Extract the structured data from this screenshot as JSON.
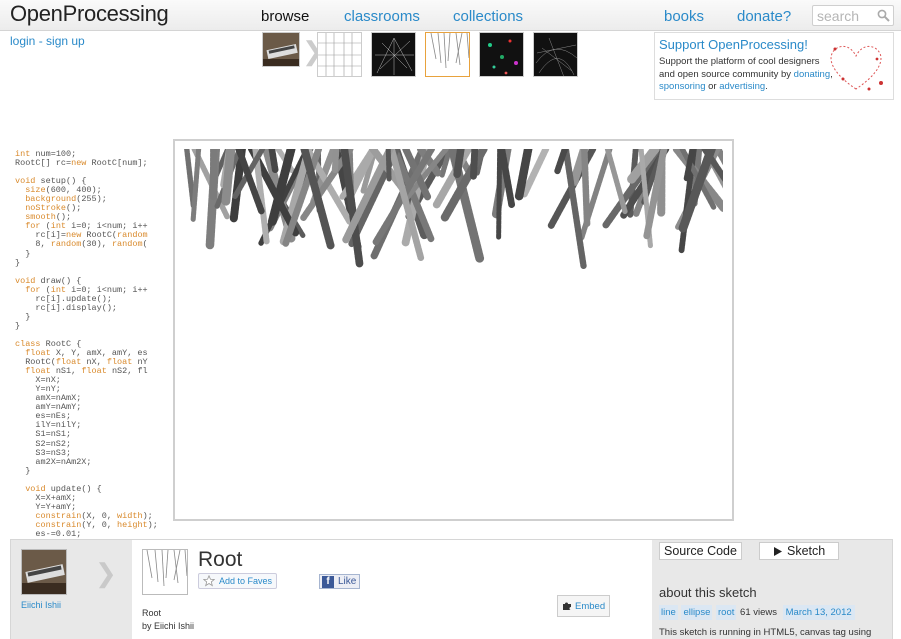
{
  "header": {
    "logo": "OpenProcessing",
    "nav": [
      "browse",
      "classrooms",
      "collections"
    ],
    "nav_right": [
      "books",
      "donate?"
    ],
    "search_placeholder": "search",
    "login": "login",
    "signup": "sign up",
    "login_sep": " - "
  },
  "support": {
    "title": "Support OpenProcessing!",
    "text": "Support the platform of cool designers and open source community by",
    "link1": "donating",
    "link2": "sponsoring",
    "sep1": ", ",
    "sep2": " or ",
    "link3": "advertising",
    "end": "."
  },
  "code_lines": [
    "int num=100;",
    "RootC[] rc=new RootC[num];",
    "",
    "void setup() {",
    "  size(600, 400);",
    "  background(255);",
    "  noStroke();",
    "  smooth();",
    "  for (int i=0; i<num; i++",
    "    rc[i]=new RootC(random",
    "    8, random(30), random(",
    "  }",
    "}",
    "",
    "void draw() {",
    "  for (int i=0; i<num; i++",
    "    rc[i].update();",
    "    rc[i].display();",
    "  }",
    "}",
    "",
    "class RootC {",
    "  float X, Y, amX, amY, es",
    "  RootC(float nX, float nY",
    "  float nS1, float nS2, fl",
    "    X=nX;",
    "    Y=nY;",
    "    amX=nAmX;",
    "    amY=nAmY;",
    "    es=nEs;",
    "    ilY=nilY;",
    "    S1=nS1;",
    "    S2=nS2;",
    "    S3=nS3;",
    "    am2X=nAm2X;",
    "  }",
    "",
    "  void update() {",
    "    X=X+amX;",
    "    Y=Y+amY;",
    "    constrain(X, 0, width);",
    "    constrain(Y, 0, height);",
    "    es-=0.01;"
  ],
  "sketch": {
    "title": "Root",
    "author": "Eiichi Ishii",
    "by_line": "by Eiichi Ishii",
    "name_line": "Root",
    "add_faves": "Add to Faves",
    "like": "Like",
    "fb_glyph": "f",
    "embed": "Embed",
    "source_code": "Source Code",
    "sketch_btn": "Sketch",
    "about": "about this sketch",
    "tags": [
      "line",
      "ellipse",
      "root"
    ],
    "views": "61 views",
    "date": "March 13, 2012",
    "note": "This sketch is running in HTML5, canvas tag using"
  },
  "colors": {
    "link": "#2a8ac9",
    "selected_thumb_border": "#e8a23d"
  }
}
